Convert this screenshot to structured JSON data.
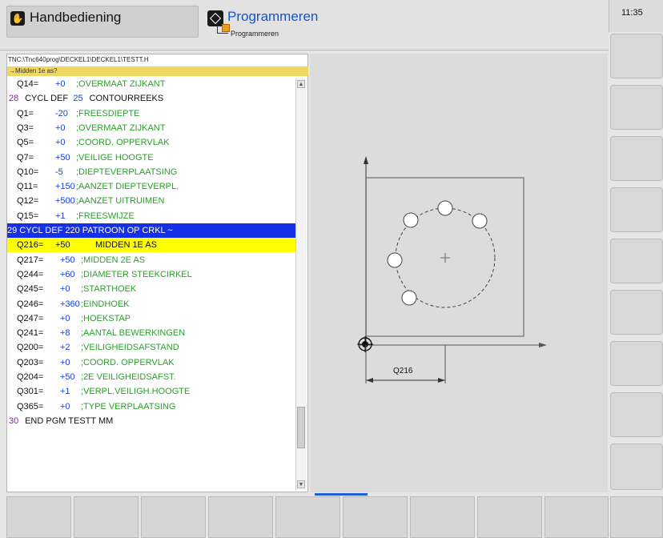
{
  "header": {
    "mode_manual": "Handbediening",
    "mode_program": "Programmeren",
    "mode_program_sub": "Programmeren",
    "clock": "11:35"
  },
  "program": {
    "path": "TNC:\\Tnc640prog\\DECKEL1\\DECKEL1\\TESTT.H",
    "dialog": "→Midden 1e as?",
    "lines": [
      {
        "segs": [
          {
            "t": "Q14=",
            "c": "c-key"
          },
          {
            "t": "+0",
            "c": "c-blue"
          },
          {
            "t": ";OVERMAAT ZIJKANT",
            "c": "c-green"
          }
        ]
      },
      {
        "segs": [
          {
            "t": "28 ",
            "c": "c-num"
          },
          {
            "t": "CYCL DEF ",
            "c": "c-key"
          },
          {
            "t": "25 ",
            "c": "c-blue"
          },
          {
            "t": "CONTOURREEKS",
            "c": "c-key"
          }
        ]
      },
      {
        "segs": [
          {
            "t": "Q1=",
            "c": "c-key"
          },
          {
            "t": "-20",
            "c": "c-blue"
          },
          {
            "t": ";FREESDIEPTE",
            "c": "c-green"
          }
        ]
      },
      {
        "segs": [
          {
            "t": "Q3=",
            "c": "c-key"
          },
          {
            "t": "+0",
            "c": "c-blue"
          },
          {
            "t": ";OVERMAAT ZIJKANT",
            "c": "c-green"
          }
        ]
      },
      {
        "segs": [
          {
            "t": "Q5=",
            "c": "c-key"
          },
          {
            "t": "+0",
            "c": "c-blue"
          },
          {
            "t": ";COORD. OPPERVLAK",
            "c": "c-green"
          }
        ]
      },
      {
        "segs": [
          {
            "t": "Q7=",
            "c": "c-key"
          },
          {
            "t": "+50",
            "c": "c-blue"
          },
          {
            "t": ";VEILIGE HOOGTE",
            "c": "c-green"
          }
        ]
      },
      {
        "segs": [
          {
            "t": "Q10=",
            "c": "c-key"
          },
          {
            "t": "-5",
            "c": "c-blue"
          },
          {
            "t": ";DIEPTEVERPLAATSING",
            "c": "c-green"
          }
        ]
      },
      {
        "segs": [
          {
            "t": "Q11=",
            "c": "c-key"
          },
          {
            "t": "+150",
            "c": "c-blue"
          },
          {
            "t": ";AANZET DIEPTEVERPL.",
            "c": "c-green"
          }
        ]
      },
      {
        "segs": [
          {
            "t": "Q12=",
            "c": "c-key"
          },
          {
            "t": "+500",
            "c": "c-blue"
          },
          {
            "t": ";AANZET UITRUIMEN",
            "c": "c-green"
          }
        ]
      },
      {
        "segs": [
          {
            "t": "Q15=",
            "c": "c-key"
          },
          {
            "t": "+1",
            "c": "c-blue"
          },
          {
            "t": ";FREESWIJZE",
            "c": "c-green"
          }
        ]
      },
      {
        "bg": "blue-bg",
        "segs": [
          {
            "t": "29 CYCL DEF 220 PATROON OP CRKL ~",
            "c": "c-white"
          }
        ]
      },
      {
        "bg": "yellow-bg",
        "segs": [
          {
            "t": "Q216=",
            "c": "c-dark"
          },
          {
            "t": "+50",
            "c": "c-dark"
          },
          {
            "t": "MIDDEN 1E AS",
            "c": "c-dark"
          }
        ]
      },
      {
        "segs": [
          {
            "t": "Q217=",
            "c": "c-key"
          },
          {
            "t": "+50",
            "c": "c-blue"
          },
          {
            "t": ";MIDDEN 2E AS",
            "c": "c-green"
          }
        ]
      },
      {
        "segs": [
          {
            "t": "Q244=",
            "c": "c-key"
          },
          {
            "t": "+60",
            "c": "c-blue"
          },
          {
            "t": ";DIAMETER STEEKCIRKEL",
            "c": "c-green"
          }
        ]
      },
      {
        "segs": [
          {
            "t": "Q245=",
            "c": "c-key"
          },
          {
            "t": "+0",
            "c": "c-blue"
          },
          {
            "t": ";STARTHOEK",
            "c": "c-green"
          }
        ]
      },
      {
        "segs": [
          {
            "t": "Q246=",
            "c": "c-key"
          },
          {
            "t": "+360",
            "c": "c-blue"
          },
          {
            "t": ";EINDHOEK",
            "c": "c-green"
          }
        ]
      },
      {
        "segs": [
          {
            "t": "Q247=",
            "c": "c-key"
          },
          {
            "t": "+0",
            "c": "c-blue"
          },
          {
            "t": ";HOEKSTAP",
            "c": "c-green"
          }
        ]
      },
      {
        "segs": [
          {
            "t": "Q241=",
            "c": "c-key"
          },
          {
            "t": "+8",
            "c": "c-blue"
          },
          {
            "t": ";AANTAL BEWERKINGEN",
            "c": "c-green"
          }
        ]
      },
      {
        "segs": [
          {
            "t": "Q200=",
            "c": "c-key"
          },
          {
            "t": "+2",
            "c": "c-blue"
          },
          {
            "t": ";VEILIGHEIDSAFSTAND",
            "c": "c-green"
          }
        ]
      },
      {
        "segs": [
          {
            "t": "Q203=",
            "c": "c-key"
          },
          {
            "t": "+0",
            "c": "c-blue"
          },
          {
            "t": ";COORD. OPPERVLAK",
            "c": "c-green"
          }
        ]
      },
      {
        "segs": [
          {
            "t": "Q204=",
            "c": "c-key"
          },
          {
            "t": "+50",
            "c": "c-blue"
          },
          {
            "t": ";2E VEILIGHEIDSAFST.",
            "c": "c-green"
          }
        ]
      },
      {
        "segs": [
          {
            "t": "Q301=",
            "c": "c-key"
          },
          {
            "t": "+1",
            "c": "c-blue"
          },
          {
            "t": ";VERPL.VEILIGH.HOOGTE",
            "c": "c-green"
          }
        ]
      },
      {
        "segs": [
          {
            "t": "Q365=",
            "c": "c-key"
          },
          {
            "t": "+0",
            "c": "c-blue"
          },
          {
            "t": ";TYPE VERPLAATSING",
            "c": "c-green"
          }
        ]
      },
      {
        "segs": [
          {
            "t": "30 ",
            "c": "c-num"
          },
          {
            "t": "END PGM TESTT MM",
            "c": "c-key"
          }
        ]
      }
    ]
  },
  "graphic": {
    "dimension_label": "Q216"
  }
}
